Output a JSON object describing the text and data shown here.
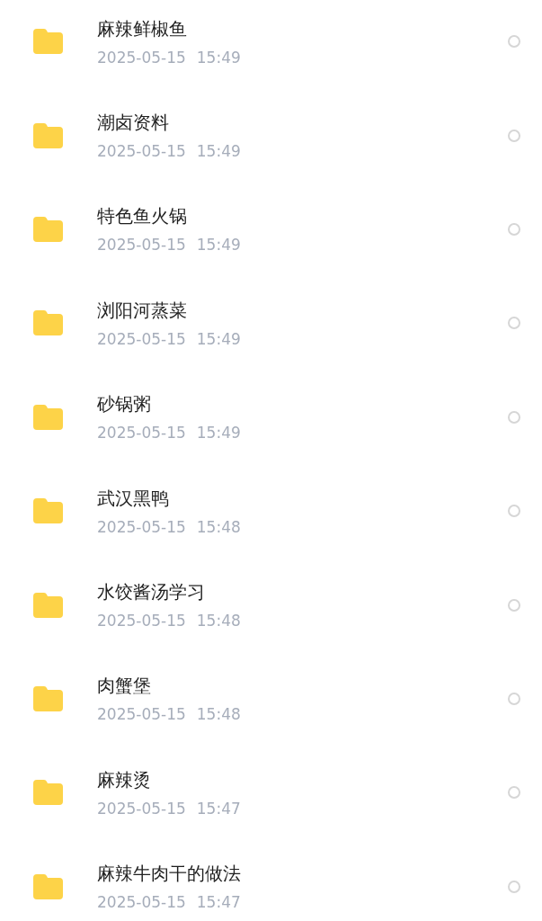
{
  "files": [
    {
      "name": "麻辣鲜椒鱼",
      "date": "2025-05-15",
      "time": "15:49",
      "selected": false
    },
    {
      "name": "潮卤资料",
      "date": "2025-05-15",
      "time": "15:49",
      "selected": false
    },
    {
      "name": "特色鱼火锅",
      "date": "2025-05-15",
      "time": "15:49",
      "selected": false
    },
    {
      "name": "浏阳河蒸菜",
      "date": "2025-05-15",
      "time": "15:49",
      "selected": false
    },
    {
      "name": "砂锅粥",
      "date": "2025-05-15",
      "time": "15:49",
      "selected": false
    },
    {
      "name": "武汉黑鸭",
      "date": "2025-05-15",
      "time": "15:48",
      "selected": false
    },
    {
      "name": "水饺酱汤学习",
      "date": "2025-05-15",
      "time": "15:48",
      "selected": false
    },
    {
      "name": "肉蟹堡",
      "date": "2025-05-15",
      "time": "15:48",
      "selected": false
    },
    {
      "name": "麻辣烫",
      "date": "2025-05-15",
      "time": "15:47",
      "selected": false
    },
    {
      "name": "麻辣牛肉干的做法",
      "date": "2025-05-15",
      "time": "15:47",
      "selected": false
    }
  ]
}
